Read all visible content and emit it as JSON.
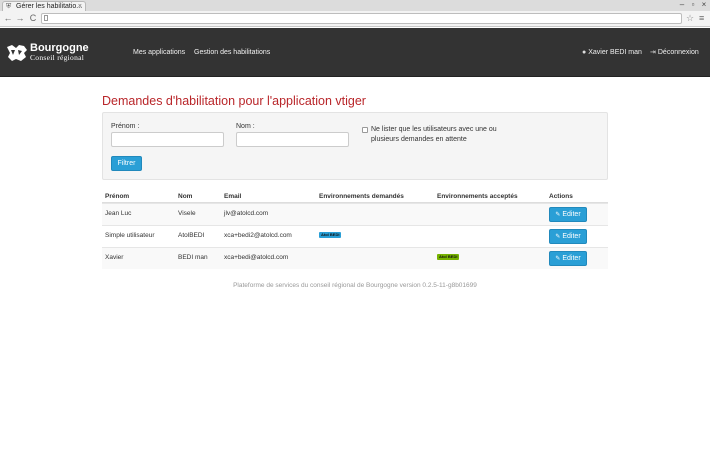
{
  "browser": {
    "tab_title": "Gérer les habilitatio...",
    "tab_favicon_icon": "shield-icon",
    "tab_close": "×",
    "url": "",
    "back": "←",
    "forward": "→",
    "reload": "C",
    "star": "☆",
    "menu": "≡",
    "window_minimize": "–",
    "window_maximize": "▫",
    "window_close": "×"
  },
  "navbar": {
    "brand_name": "Bourgogne",
    "brand_sub": "Conseil régional",
    "links": [
      {
        "label": "Mes applications"
      },
      {
        "label": "Gestion des habilitations"
      }
    ],
    "user_icon": "user-icon",
    "user_name": "Xavier BEDI man",
    "logout_icon": "logout-icon",
    "logout_label": "Déconnexion",
    "colors": {
      "background": "#333333",
      "text": "#ffffff"
    }
  },
  "page": {
    "title": "Demandes d'habilitation pour l'application vtiger",
    "title_color": "#b9262a"
  },
  "filter": {
    "prenom_label": "Prénom :",
    "prenom_value": "",
    "nom_label": "Nom :",
    "nom_value": "",
    "pending_checkbox_checked": false,
    "pending_checkbox_label": "Ne lister que les utilisateurs avec une ou plusieurs demandes en attente",
    "submit_label": "Filtrer",
    "button_color": "#2a9fd6"
  },
  "table": {
    "headers": {
      "prenom": "Prénom",
      "nom": "Nom",
      "email": "Email",
      "env_requested": "Environnements demandés",
      "env_accepted": "Environnements acceptés",
      "actions": "Actions"
    },
    "rows": [
      {
        "prenom": "Jean Luc",
        "nom": "Visele",
        "email": "jlv@atolcd.com",
        "env_requested": "",
        "env_accepted": "",
        "action": "Editer"
      },
      {
        "prenom": "Simple utilisateur",
        "nom": "AtolBEDI",
        "email": "xca+bedi2@atolcd.com",
        "env_requested": "Atol BEDI",
        "env_accepted": "",
        "action": "Editer"
      },
      {
        "prenom": "Xavier",
        "nom": "BEDI man",
        "email": "xca+bedi@atolcd.com",
        "env_requested": "",
        "env_accepted": "Atol BEDI",
        "action": "Editer"
      }
    ],
    "badge_colors": {
      "requested": "#2a9fd6",
      "accepted": "#77b300"
    },
    "edit_icon": "pencil-icon"
  },
  "footer": {
    "text": "Plateforme de services du conseil régional de Bourgogne version 0.2.5-11-g8b01699"
  }
}
